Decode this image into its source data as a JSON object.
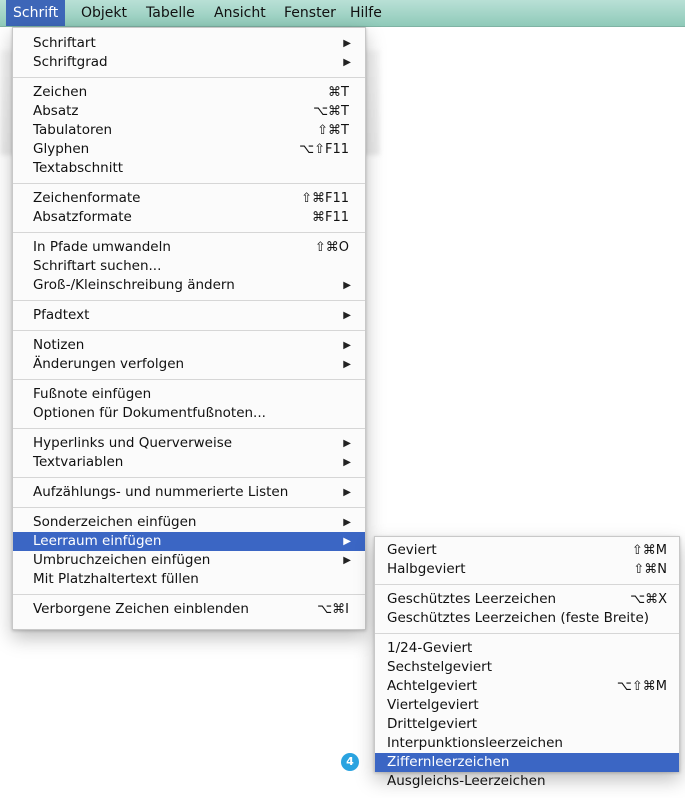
{
  "menubar": {
    "items": [
      "Schrift",
      "Objekt",
      "Tabelle",
      "Ansicht",
      "Fenster",
      "Hilfe"
    ],
    "active": "Schrift"
  },
  "menu": {
    "items": [
      {
        "label": "Schriftart",
        "submenu": true
      },
      {
        "label": "Schriftgrad",
        "submenu": true
      },
      {
        "separator": true
      },
      {
        "label": "Zeichen",
        "shortcut": "⌘T"
      },
      {
        "label": "Absatz",
        "shortcut": "⌥⌘T"
      },
      {
        "label": "Tabulatoren",
        "shortcut": "⇧⌘T"
      },
      {
        "label": "Glyphen",
        "shortcut": "⌥⇧F11"
      },
      {
        "label": "Textabschnitt"
      },
      {
        "separator": true
      },
      {
        "label": "Zeichenformate",
        "shortcut": "⇧⌘F11"
      },
      {
        "label": "Absatzformate",
        "shortcut": "⌘F11"
      },
      {
        "separator": true
      },
      {
        "label": "In Pfade umwandeln",
        "shortcut": "⇧⌘O"
      },
      {
        "label": "Schriftart suchen..."
      },
      {
        "label": "Groß-/Kleinschreibung ändern",
        "submenu": true
      },
      {
        "separator": true
      },
      {
        "label": "Pfadtext",
        "submenu": true
      },
      {
        "separator": true
      },
      {
        "label": "Notizen",
        "submenu": true
      },
      {
        "label": "Änderungen verfolgen",
        "submenu": true
      },
      {
        "separator": true
      },
      {
        "label": "Fußnote einfügen"
      },
      {
        "label": "Optionen für Dokumentfußnoten..."
      },
      {
        "separator": true
      },
      {
        "label": "Hyperlinks und Querverweise",
        "submenu": true
      },
      {
        "label": "Textvariablen",
        "submenu": true
      },
      {
        "separator": true
      },
      {
        "label": "Aufzählungs- und nummerierte Listen",
        "submenu": true
      },
      {
        "separator": true
      },
      {
        "label": "Sonderzeichen einfügen",
        "submenu": true
      },
      {
        "label": "Leerraum einfügen",
        "submenu": true,
        "highlighted": true
      },
      {
        "label": "Umbruchzeichen einfügen",
        "submenu": true
      },
      {
        "label": "Mit Platzhaltertext füllen"
      },
      {
        "separator": true
      },
      {
        "label": "Verborgene Zeichen einblenden",
        "shortcut": "⌥⌘I"
      }
    ]
  },
  "submenu": {
    "items": [
      {
        "label": "Geviert",
        "shortcut": "⇧⌘M"
      },
      {
        "label": "Halbgeviert",
        "shortcut": "⇧⌘N"
      },
      {
        "separator": true
      },
      {
        "label": "Geschütztes Leerzeichen",
        "shortcut": "⌥⌘X"
      },
      {
        "label": "Geschütztes Leerzeichen (feste Breite)"
      },
      {
        "separator": true
      },
      {
        "label": "1/24-Geviert"
      },
      {
        "label": "Sechstelgeviert"
      },
      {
        "label": "Achtelgeviert",
        "shortcut": "⌥⇧⌘M"
      },
      {
        "label": "Viertelgeviert"
      },
      {
        "label": "Drittelgeviert"
      },
      {
        "label": "Interpunktionsleerzeichen"
      },
      {
        "label": "Ziffernleerzeichen",
        "highlighted": true
      },
      {
        "label": "Ausgleichs-Leerzeichen"
      }
    ]
  },
  "callout": {
    "number": "4",
    "color": "#2aa3e0"
  },
  "colors": {
    "highlight": "#3b66c4",
    "menubar": "#a4d6c8"
  }
}
